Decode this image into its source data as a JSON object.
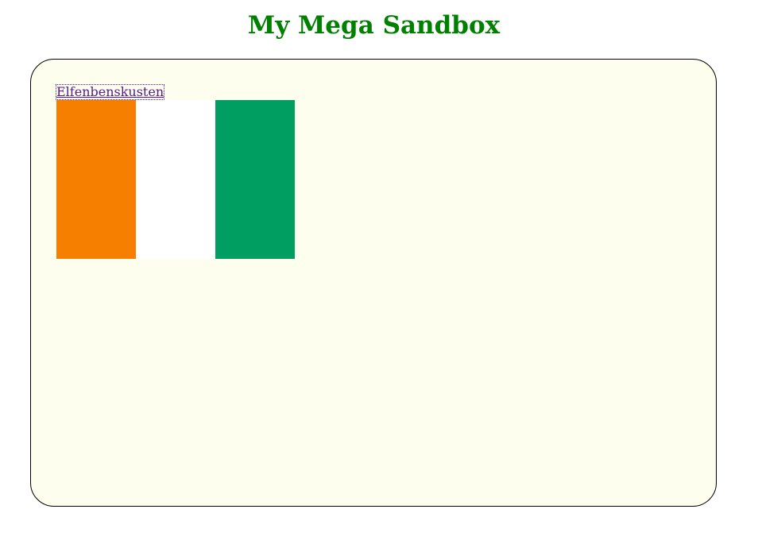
{
  "page": {
    "title": "My Mega Sandbox"
  },
  "sandbox": {
    "link_text": "Elfenbenskusten",
    "flag": {
      "country": "Elfenbenskusten",
      "stripes": [
        "#f77f00",
        "#ffffff",
        "#009e60"
      ]
    }
  },
  "colors": {
    "title": "#008000",
    "panel_background": "#fdfeee",
    "panel_border": "#000000",
    "link": "#551a8b"
  }
}
